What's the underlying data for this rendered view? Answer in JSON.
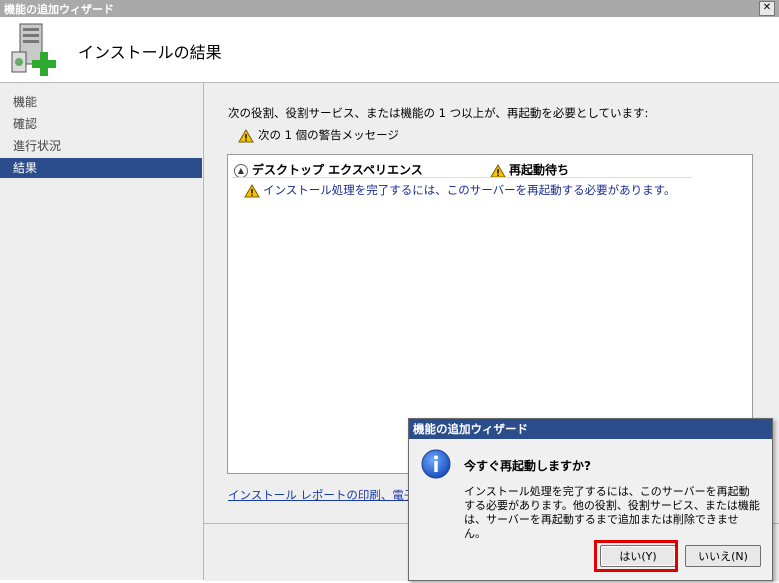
{
  "window": {
    "title": "機能の追加ウィザード",
    "close_label": "✕"
  },
  "header": {
    "title": "インストールの結果"
  },
  "nav": {
    "items": [
      {
        "label": "機能"
      },
      {
        "label": "確認"
      },
      {
        "label": "進行状況"
      },
      {
        "label": "結果"
      }
    ],
    "selected": "結果"
  },
  "content": {
    "intro": "次の役割、役割サービス、または機能の 1 つ以上が、再起動を必要としています:",
    "warning_summary": "次の 1 個の警告メッセージ",
    "result_row": {
      "feature": "デスクトップ エクスペリエンス",
      "status": "再起動待ち",
      "detail": "インストール処理を完了するには、このサーバーを再起動する必要があります。"
    },
    "link": "インストール レポートの印刷、電子メー"
  },
  "dialog": {
    "title": "機能の追加ウィザード",
    "question": "今すぐ再起動しますか?",
    "body": "インストール処理を完了するには、このサーバーを再起動する必要があります。他の役割、役割サービス、または機能は、サーバーを再起動するまで追加または削除できません。",
    "yes_label": "はい(Y)",
    "no_label": "いいえ(N)"
  },
  "colors": {
    "selection": "#2c4d8b",
    "dialog_title": "#2b4d8c",
    "highlight": "#e00000",
    "link": "#1a3aa8"
  },
  "icons": {
    "header": "server-add-icon",
    "warning": "warning-triangle-icon",
    "info": "info-icon",
    "collapse": "chevron-up-icon"
  }
}
